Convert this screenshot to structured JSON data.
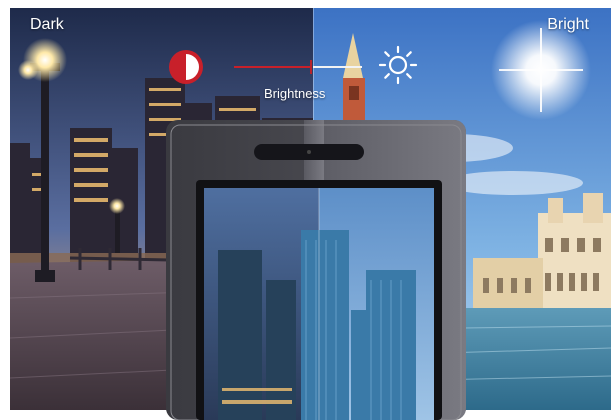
{
  "labels": {
    "dark": "Dark",
    "bright": "Bright",
    "brightness": "Brightness"
  },
  "brightness_slider": {
    "value": 0.6
  },
  "icons": {
    "contrast": "contrast-half-circle-icon",
    "sun": "sun-icon"
  },
  "colors": {
    "accent_red": "#c8202a",
    "slider_right": "#f3f3f3"
  }
}
